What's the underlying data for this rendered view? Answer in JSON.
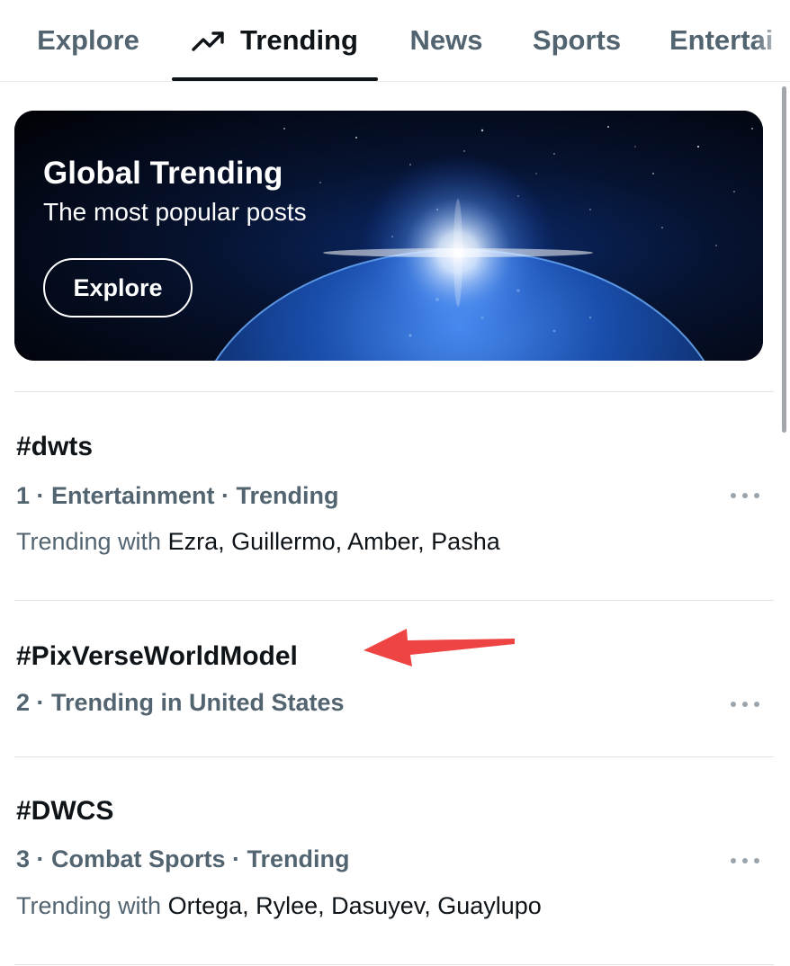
{
  "tabs": [
    {
      "label": "Explore",
      "active": false
    },
    {
      "label": "Trending",
      "active": true,
      "icon": "trending-arrow-icon"
    },
    {
      "label": "News",
      "active": false
    },
    {
      "label": "Sports",
      "active": false
    },
    {
      "label": "Entertai",
      "active": false
    }
  ],
  "banner": {
    "title": "Global Trending",
    "subtitle": "The most popular posts",
    "button_label": "Explore",
    "image": "earth-from-space-sunrise"
  },
  "trends": [
    {
      "title": "#dwts",
      "meta": "1 · Entertainment · Trending",
      "with_prefix": "Trending with",
      "with_names": " Ezra, Guillermo, Amber, Pasha"
    },
    {
      "title": "#PixVerseWorldModel",
      "meta": "2 · Trending in United States",
      "with_prefix": "",
      "with_names": ""
    },
    {
      "title": "#DWCS",
      "meta": "3 · Combat Sports · Trending",
      "with_prefix": "Trending with",
      "with_names": " Ortega, Rylee, Dasuyev, Guaylupo"
    }
  ],
  "annotation": {
    "arrow_color": "#ef4444",
    "points_to": "#PixVerseWorldModel"
  },
  "colors": {
    "text": "#0f1419",
    "muted": "#536471",
    "divider": "#e1e4e6"
  }
}
